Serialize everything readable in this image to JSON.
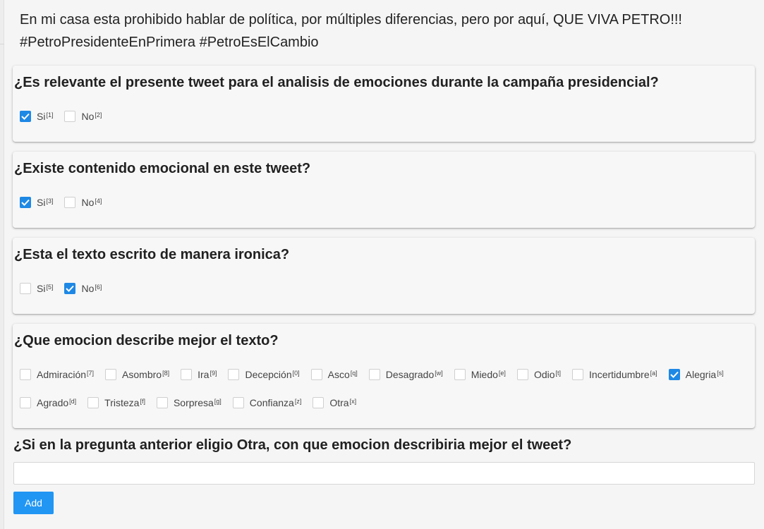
{
  "tweet": {
    "line1": "En mi casa esta prohibido hablar de política, por múltiples diferencias, pero por aquí, QUE VIVA PETRO!!!",
    "line2": "#PetroPresidenteEnPrimera #PetroEsElCambio"
  },
  "q1": {
    "title": "¿Es relevante el presente tweet para el analisis de emociones durante la campaña presidencial?",
    "options": [
      {
        "label": "Si",
        "key": "[1]",
        "checked": true
      },
      {
        "label": "No",
        "key": "[2]",
        "checked": false
      }
    ]
  },
  "q2": {
    "title": "¿Existe contenido emocional en este tweet?",
    "options": [
      {
        "label": "Si",
        "key": "[3]",
        "checked": true
      },
      {
        "label": "No",
        "key": "[4]",
        "checked": false
      }
    ]
  },
  "q3": {
    "title": "¿Esta el texto escrito de manera ironica?",
    "options": [
      {
        "label": "Si",
        "key": "[5]",
        "checked": false
      },
      {
        "label": "No",
        "key": "[6]",
        "checked": true
      }
    ]
  },
  "q4": {
    "title": "¿Que emocion describe mejor el texto?",
    "row1": [
      {
        "label": "Admiración",
        "key": "[7]",
        "checked": false
      },
      {
        "label": "Asombro",
        "key": "[8]",
        "checked": false
      },
      {
        "label": "Ira",
        "key": "[9]",
        "checked": false
      },
      {
        "label": "Decepción",
        "key": "[0]",
        "checked": false
      },
      {
        "label": "Asco",
        "key": "[q]",
        "checked": false
      },
      {
        "label": "Desagrado",
        "key": "[w]",
        "checked": false
      },
      {
        "label": "Miedo",
        "key": "[e]",
        "checked": false
      },
      {
        "label": "Odio",
        "key": "[t]",
        "checked": false
      },
      {
        "label": "Incertidumbre",
        "key": "[a]",
        "checked": false
      },
      {
        "label": "Alegria",
        "key": "[s]",
        "checked": true
      }
    ],
    "row2": [
      {
        "label": "Agrado",
        "key": "[d]",
        "checked": false
      },
      {
        "label": "Tristeza",
        "key": "[f]",
        "checked": false
      },
      {
        "label": "Sorpresa",
        "key": "[g]",
        "checked": false
      },
      {
        "label": "Confianza",
        "key": "[z]",
        "checked": false
      },
      {
        "label": "Otra",
        "key": "[x]",
        "checked": false
      }
    ]
  },
  "q5": {
    "title": "¿Si en la pregunta anterior eligio Otra, con que emocion describiria mejor el tweet?",
    "value": ""
  },
  "actions": {
    "add_label": "Add"
  },
  "colors": {
    "accent": "#2196f3",
    "checked": "#1e88e5"
  }
}
